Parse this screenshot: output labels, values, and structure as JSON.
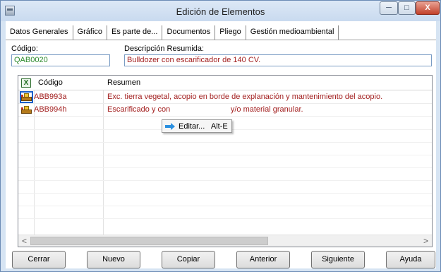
{
  "window": {
    "title": "Edición de Elementos",
    "min_glyph": "─",
    "max_glyph": "□",
    "close_glyph": "X"
  },
  "tabs": [
    {
      "label": "Datos Generales"
    },
    {
      "label": "Gráfico"
    },
    {
      "label": "Es parte de..."
    },
    {
      "label": "Documentos"
    },
    {
      "label": "Pliego"
    },
    {
      "label": "Gestión medioambiental"
    }
  ],
  "form": {
    "codigo_label": "Código:",
    "codigo_value": "QAB0020",
    "desc_label": "Descripción Resumida:",
    "desc_value": "Bulldozer con escarificador de 140 CV."
  },
  "grid": {
    "export_icon_text": "X",
    "headers": {
      "codigo": "Código",
      "resumen": "Resumen"
    },
    "rows": [
      {
        "codigo": "ABB993a",
        "resumen": "Exc. tierra vegetal, acopio en borde de explanación y mantenimiento del acopio."
      },
      {
        "codigo": "ABB994h",
        "resumen": "Escarificado y con                            y/o material granular."
      }
    ],
    "scroll_left": "<",
    "scroll_right": ">"
  },
  "context_menu": {
    "item": "Editar...   Alt-E"
  },
  "buttons": {
    "cerrar": "Cerrar",
    "nuevo": "Nuevo",
    "copiar": "Copiar",
    "anterior": "Anterior",
    "siguiente": "Siguiente",
    "ayuda": "Ayuda"
  }
}
